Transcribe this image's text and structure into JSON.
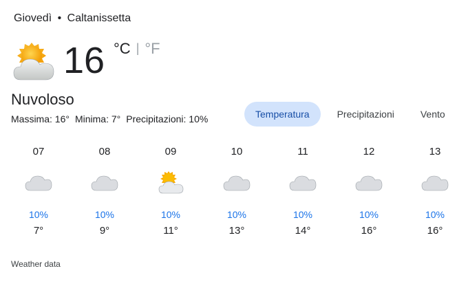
{
  "header": {
    "day": "Giovedì",
    "separator": "•",
    "location": "Caltanissetta"
  },
  "current": {
    "icon": "partly-cloudy-icon",
    "temperature": "16",
    "unit_c": "°C",
    "unit_divider": "|",
    "unit_f": "°F",
    "condition": "Nuvoloso",
    "max": "Massima: 16°",
    "min": "Minima: 7°",
    "precip": "Precipitazioni: 10%"
  },
  "tabs": [
    {
      "label": "Temperatura",
      "active": true
    },
    {
      "label": "Precipitazioni",
      "active": false
    },
    {
      "label": "Vento",
      "active": false
    }
  ],
  "days": [
    {
      "label": "07",
      "icon": "cloudy-icon",
      "precip": "10%",
      "max": "7°"
    },
    {
      "label": "08",
      "icon": "cloudy-icon",
      "precip": "10%",
      "max": "9°"
    },
    {
      "label": "09",
      "icon": "partly-cloudy-icon",
      "precip": "10%",
      "max": "11°"
    },
    {
      "label": "10",
      "icon": "cloudy-icon",
      "precip": "10%",
      "max": "13°"
    },
    {
      "label": "11",
      "icon": "cloudy-icon",
      "precip": "10%",
      "max": "14°"
    },
    {
      "label": "12",
      "icon": "cloudy-icon",
      "precip": "10%",
      "max": "16°"
    },
    {
      "label": "13",
      "icon": "cloudy-icon",
      "precip": "10%",
      "max": "16°"
    }
  ],
  "footer": "Weather data",
  "colors": {
    "accent": "#1a73e8",
    "active_tab_bg": "#d2e3fc",
    "sun": "#f9ab00",
    "cloud": "#dadce0"
  }
}
